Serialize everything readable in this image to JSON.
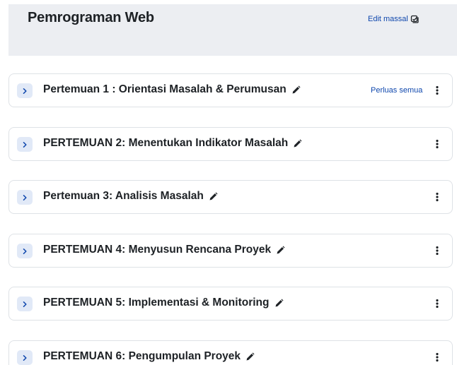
{
  "header": {
    "course_title": "Pemrograman Web",
    "edit_massal_label": "Edit massal",
    "edit_icon": "bulk-edit-icon"
  },
  "sections": [
    {
      "title": "Pertemuan 1 : Orientasi Masalah & Perumusan",
      "action_label": "Perluas semua"
    },
    {
      "title": "PERTEMUAN 2: Menentukan Indikator Masalah"
    },
    {
      "title": "Pertemuan 3: Analisis Masalah"
    },
    {
      "title": "PERTEMUAN 4: Menyusun Rencana Proyek"
    },
    {
      "title": "PERTEMUAN 5: Implementasi & Monitoring"
    },
    {
      "title": "PERTEMUAN 6: Pengumpulan Proyek"
    }
  ],
  "icons": {
    "toggle": "chevron-right-icon",
    "edit": "pencil-icon",
    "menu": "kebab-menu-icon"
  },
  "colors": {
    "accent": "#0f47ad",
    "header_bg": "#eceef2",
    "toggle_bg": "#e1e9f7",
    "text": "#1d2125",
    "border": "#dee2e6"
  }
}
